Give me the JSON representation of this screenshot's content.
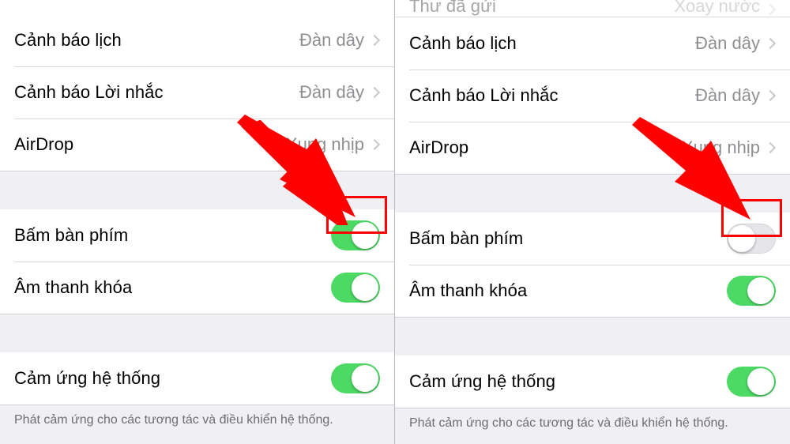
{
  "left": {
    "group1": {
      "row1": {
        "label": "Cảnh báo lịch",
        "value": "Đàn dây"
      },
      "row2": {
        "label": "Cảnh báo Lời nhắc",
        "value": "Đàn dây"
      },
      "row3": {
        "label": "AirDrop",
        "value": "Xung nhịp"
      }
    },
    "group2": {
      "row1": {
        "label": "Bấm bàn phím",
        "toggle": "on"
      },
      "row2": {
        "label": "Âm thanh khóa",
        "toggle": "on"
      }
    },
    "group3": {
      "row1": {
        "label": "Cảm ứng hệ thống",
        "toggle": "on"
      }
    },
    "footer": "Phát cảm ứng cho các tương tác và điều khiển hệ thống."
  },
  "right": {
    "partial_top": {
      "label": "Thư đã gửi",
      "value": "Xoay nước"
    },
    "group1": {
      "row1": {
        "label": "Cảnh báo lịch",
        "value": "Đàn dây"
      },
      "row2": {
        "label": "Cảnh báo Lời nhắc",
        "value": "Đàn dây"
      },
      "row3": {
        "label": "AirDrop",
        "value": "Xung nhịp"
      }
    },
    "group2": {
      "row1": {
        "label": "Bấm bàn phím",
        "toggle": "off"
      },
      "row2": {
        "label": "Âm thanh khóa",
        "toggle": "on"
      }
    },
    "group3": {
      "row1": {
        "label": "Cảm ứng hệ thống",
        "toggle": "on"
      }
    },
    "footer": "Phát cảm ứng cho các tương tác và điều khiển hệ thống."
  }
}
